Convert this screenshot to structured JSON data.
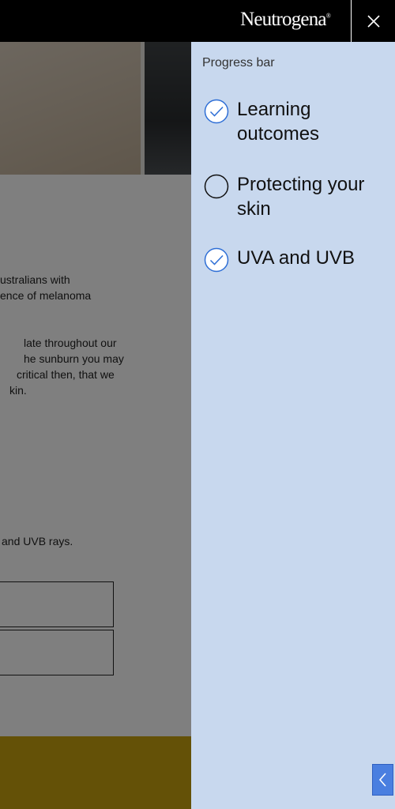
{
  "header": {
    "brand": "Neutrogena",
    "brand_mark": "®"
  },
  "background_page": {
    "paragraph1": [
      "ustralians with",
      "ence of melanoma"
    ],
    "paragraph2": [
      "late throughout our",
      "he sunburn you may",
      "critical then, that we",
      "kin."
    ],
    "paragraph3": "and UVB rays."
  },
  "panel": {
    "title": "Progress bar",
    "steps": [
      {
        "label": "Learning outcomes",
        "completed": true
      },
      {
        "label": "Protecting your skin",
        "completed": false
      },
      {
        "label": "UVA and UVB",
        "completed": true
      }
    ]
  },
  "colors": {
    "panel_bg": "#c8d8ee",
    "accent": "#2f6fd6",
    "header_bg": "#000000",
    "yellow_band": "#c9a20f"
  },
  "icons": {
    "close": "close-icon",
    "check": "check-circle-icon",
    "empty": "empty-circle-icon",
    "collapse": "chevron-left-icon"
  }
}
